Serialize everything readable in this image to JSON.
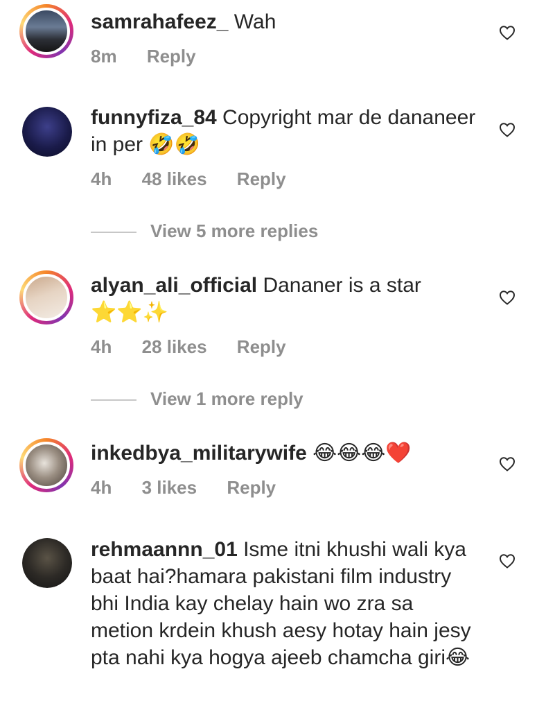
{
  "comments": [
    {
      "user": "samrahafeez_",
      "text": " Wah",
      "time": "8m",
      "likes": "",
      "reply": "Reply"
    },
    {
      "user": "funnyfiza_84",
      "text": " Copyright mar de dananeer in per 🤣🤣",
      "time": "4h",
      "likes": "48 likes",
      "reply": "Reply"
    },
    {
      "user": "alyan_ali_official",
      "text": " Dananer is a star ⭐⭐✨",
      "time": "4h",
      "likes": "28 likes",
      "reply": "Reply"
    },
    {
      "user": "inkedbya_militarywife",
      "text": " 😂😂😂❤️",
      "time": "4h",
      "likes": "3 likes",
      "reply": "Reply"
    },
    {
      "user": "rehmaannn_01",
      "text": " Isme itni khushi wali kya baat hai?hamara pakistani film industry bhi India kay chelay hain wo zra sa metion krdein khush aesy hotay hain jesy pta nahi kya hogya ajeeb chamcha giri😂",
      "time": "",
      "likes": "",
      "reply": ""
    }
  ],
  "view_more": [
    "View 5 more replies",
    "View 1 more reply"
  ],
  "icons": {
    "like": "heart-outline-icon"
  },
  "colors": {
    "text": "#262626",
    "meta": "#8e8e8e"
  }
}
